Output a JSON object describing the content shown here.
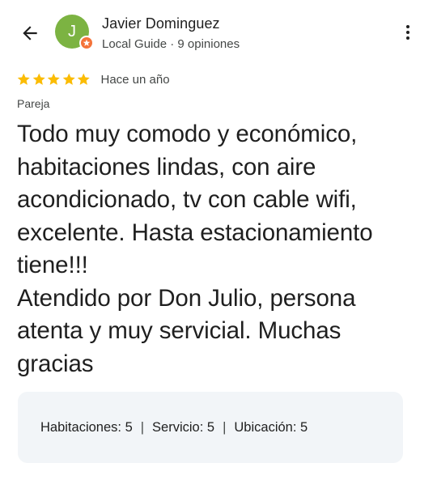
{
  "header": {
    "reviewer_name": "Javier Dominguez",
    "avatar_initial": "J",
    "reviewer_subtitle": "Local Guide · 9 opiniones",
    "avatar_color": "#7cb342",
    "badge_color": "#f4733a"
  },
  "rating": {
    "stars": 5,
    "max_stars": 5,
    "star_color": "#fbbc04",
    "date": "Hace un año"
  },
  "trip_type": "Pareja",
  "review_lines": [
    "Todo muy comodo y económico,",
    "habitaciones lindas, con aire",
    "acondicionado, tv con cable wifi,",
    "excelente. Hasta estacionamiento",
    "tiene!!!",
    "Atendido por Don Julio, persona",
    "atenta y muy servicial. Muchas",
    "gracias"
  ],
  "attributes": {
    "items": [
      {
        "label": "Habitaciones:",
        "value": "5"
      },
      {
        "label": "Servicio:",
        "value": "5"
      },
      {
        "label": "Ubicación:",
        "value": "5"
      }
    ],
    "separator": "|"
  },
  "icons": {
    "back": "arrow-back-icon",
    "menu": "more-vert-icon",
    "badge": "local-guide-star-icon",
    "star": "star-icon"
  }
}
